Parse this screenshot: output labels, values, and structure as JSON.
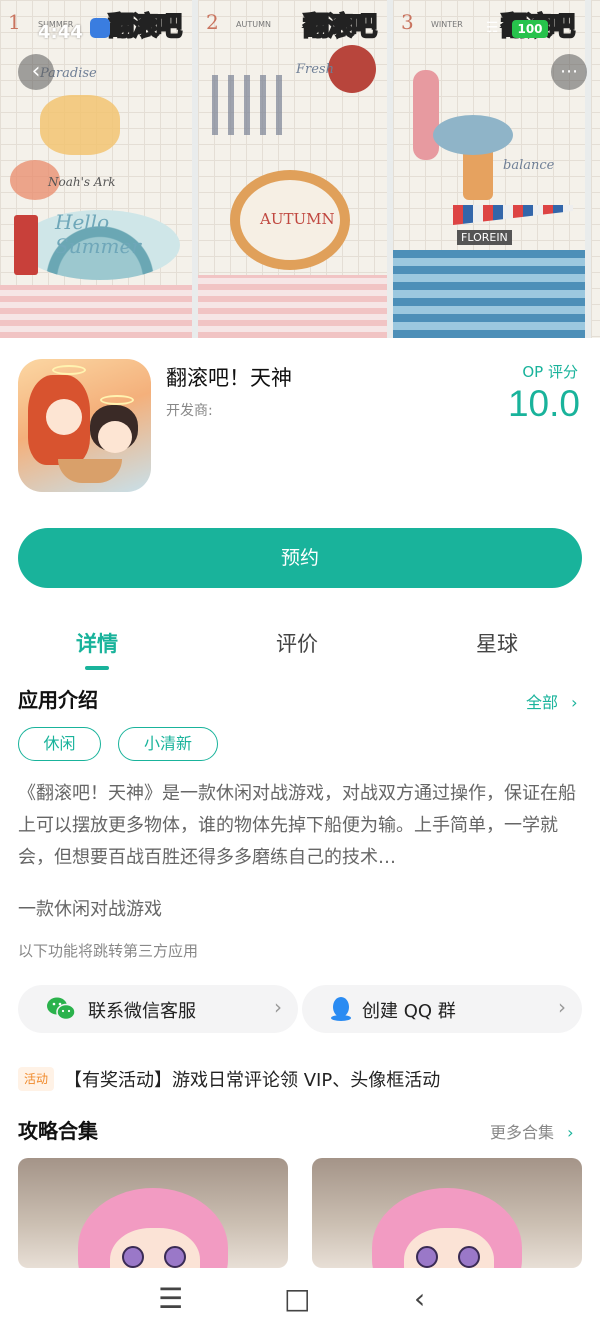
{
  "status_bar": {
    "time": "4:44",
    "battery": "100"
  },
  "gallery": {
    "screens": [
      {
        "number": "1",
        "season": "SUMMER",
        "brand": "翻滚吧",
        "labels": [
          "Paradise",
          "Noah's Ark",
          "Hello Summer"
        ]
      },
      {
        "number": "2",
        "season": "AUTUMN",
        "brand": "翻滚吧",
        "labels": [
          "Fresh",
          "AUTUMN"
        ]
      },
      {
        "number": "3",
        "season": "WINTER",
        "brand": "翻滚吧",
        "labels": [
          "balance",
          "FLOREIN"
        ]
      }
    ]
  },
  "app": {
    "name": "翻滚吧！天神",
    "developer_label": "开发商:",
    "score_label": "OP 评分",
    "score": "10.0",
    "reserve_label": "预约"
  },
  "tabs": [
    {
      "label": "详情",
      "active": true
    },
    {
      "label": "评价",
      "active": false
    },
    {
      "label": "星球",
      "active": false
    }
  ],
  "intro": {
    "title": "应用介绍",
    "all_label": "全部",
    "tags": [
      "休闲",
      "小清新"
    ],
    "description": "《翻滚吧！天神》是一款休闲对战游戏，对战双方通过操作，保证在船上可以摆放更多物体，谁的物体先掉下船便为输。上手简单，一学就会，但想要百战百胜还得多多磨练自己的技术…",
    "brief": "一款休闲对战游戏",
    "third_party_note": "以下功能将跳转第三方应用"
  },
  "links": {
    "wechat_label": "联系微信客服",
    "qq_label": "创建 QQ 群"
  },
  "promo": {
    "badge": "活动",
    "text": "【有奖活动】游戏日常评论领 VIP、头像框活动"
  },
  "guides": {
    "title": "攻略合集",
    "more_label": "更多合集"
  },
  "colors": {
    "accent": "#19b39b",
    "promo": "#f08a2b"
  }
}
